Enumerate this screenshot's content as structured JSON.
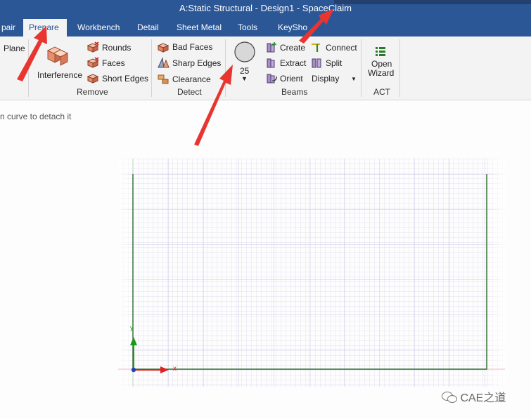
{
  "window": {
    "title": "A:Static Structural - Design1 - SpaceClaim"
  },
  "tabs": [
    {
      "label": "pair",
      "active": false
    },
    {
      "label": "Prepare",
      "active": true
    },
    {
      "label": "Workbench",
      "active": false
    },
    {
      "label": "Detail",
      "active": false
    },
    {
      "label": "Sheet Metal",
      "active": false
    },
    {
      "label": "Tools",
      "active": false
    },
    {
      "label": "KeySho",
      "active": false
    }
  ],
  "ribbon": {
    "plane_label": "Plane",
    "remove": {
      "group_label": "Remove",
      "interference_label": "Interference",
      "rounds_label": "Rounds",
      "faces_label": "Faces",
      "short_edges_label": "Short Edges"
    },
    "detect": {
      "group_label": "Detect",
      "bad_faces_label": "Bad Faces",
      "sharp_edges_label": "Sharp Edges",
      "clearance_label": "Clearance"
    },
    "beams": {
      "group_label": "Beams",
      "profile_size": "25",
      "create_label": "Create",
      "extract_label": "Extract",
      "orient_label": "Orient",
      "connect_label": "Connect",
      "split_label": "Split",
      "display_label": "Display"
    },
    "act": {
      "group_label": "ACT",
      "open_label": "Open",
      "wizard_label": "Wizard"
    }
  },
  "status": {
    "hint": "n curve to detach it"
  },
  "axes": {
    "x_label": "x",
    "y_label": "y"
  },
  "watermark": {
    "text": "CAE之道"
  },
  "colors": {
    "title_bar": "#2b5797",
    "ribbon": "#f3f3f3",
    "annotation_arrow": "#e8352f",
    "sketch_line": "#2a6a2a",
    "grid_minor": "#e0dcf0",
    "x_axis": "#e02020",
    "y_axis": "#1a9a1a"
  }
}
